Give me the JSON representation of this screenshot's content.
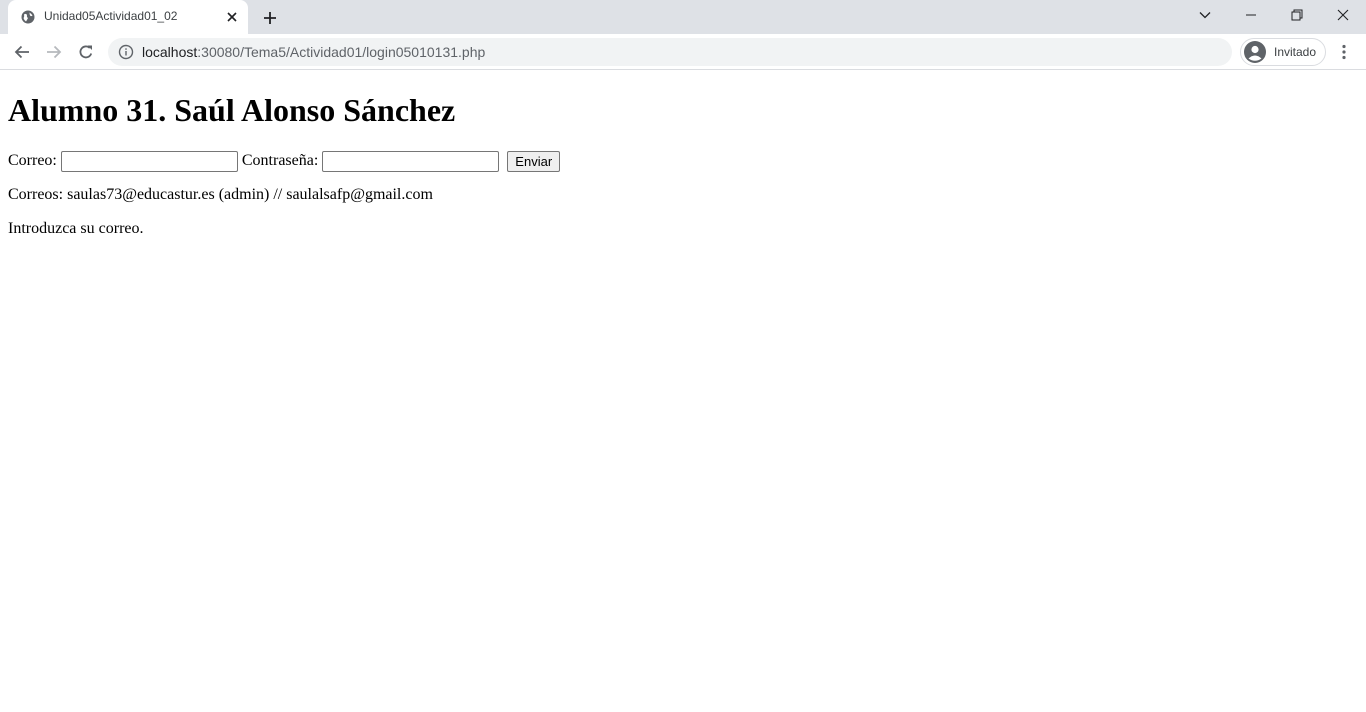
{
  "browser": {
    "tab": {
      "title": "Unidad05Actividad01_02"
    },
    "url": {
      "host": "localhost",
      "path": ":30080/Tema5/Actividad01/login05010131.php"
    },
    "profile": {
      "label": "Invitado"
    }
  },
  "page": {
    "heading": "Alumno 31. Saúl Alonso Sánchez",
    "form": {
      "email_label": "Correo:",
      "email_value": "",
      "password_label": "Contraseña:",
      "password_value": "",
      "submit_label": "Enviar"
    },
    "emails_info": "Correos: saulas73@educastur.es (admin) // saulalsafp@gmail.com",
    "message": "Introduzca su correo."
  },
  "icons": {
    "tab_favicon": "globe-icon",
    "tab_close": "close-icon",
    "new_tab": "plus-icon",
    "tab_search": "chevron-down-icon",
    "minimize": "minimize-icon",
    "restore": "restore-icon",
    "close_window": "close-icon",
    "back": "arrow-left-icon",
    "forward": "arrow-right-icon",
    "reload": "reload-icon",
    "site_info": "info-icon",
    "profile": "avatar-icon",
    "menu": "kebab-menu-icon"
  },
  "colors": {
    "tabstrip_bg": "#dee1e6",
    "omnibox_bg": "#f1f3f4",
    "page_bg": "#ffffff",
    "text": "#000000"
  }
}
